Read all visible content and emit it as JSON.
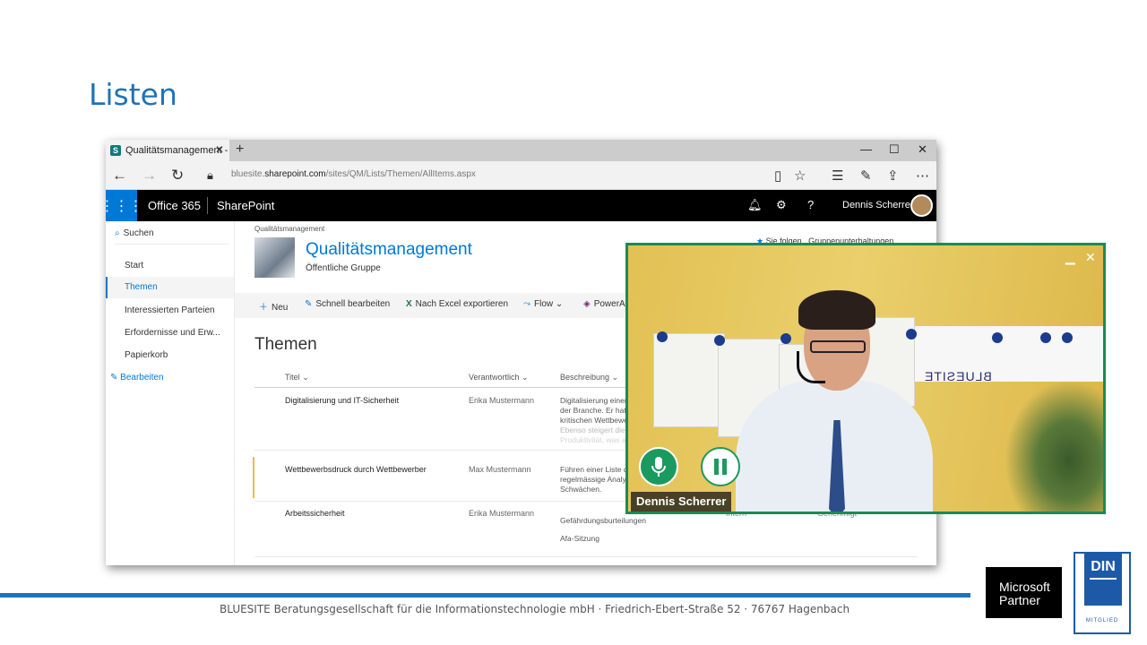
{
  "slide": {
    "title": "Listen",
    "footer": "BLUESITE Beratungsgesellschaft für die Informationstechnologie  mbH · Friedrich-Ebert-Straße 52 · 76767 Hagenbach",
    "ms_partner": [
      "Microsoft",
      "Partner"
    ],
    "din": {
      "text": "DIN",
      "sub": "MITGLIED"
    }
  },
  "browser": {
    "tab_title": "Qualitätsmanagement -",
    "url_prefix": "bluesite.",
    "url_domain": "sharepoint.com",
    "url_path": "/sites/QM/Lists/Themen/AllItems.aspx"
  },
  "o365": {
    "app": "Office 365",
    "product": "SharePoint",
    "user": "Dennis Scherrer"
  },
  "site": {
    "breadcrumb": "Qualitätsmanagement",
    "title": "Qualitätsmanagement",
    "subtitle": "Öffentliche Gruppe",
    "follow": "Sie folgen",
    "conversations": "Gruppenunterhaltungen"
  },
  "nav": {
    "search": "Suchen",
    "items": [
      "Start",
      "Themen",
      "Interessierten Parteien",
      "Erfordernisse und Erw...",
      "Papierkorb"
    ],
    "selected": "Themen",
    "edit": "Bearbeiten"
  },
  "commands": {
    "new": "Neu",
    "quick_edit": "Schnell bearbeiten",
    "excel": "Nach Excel exportieren",
    "flow": "Flow",
    "powerapps": "PowerA"
  },
  "list": {
    "title": "Themen",
    "columns": [
      "Titel",
      "Verantwortlich",
      "Beschreibung"
    ],
    "rows": [
      {
        "title": "Digitalisierung und IT-Sicherheit",
        "responsible": "Erika Mustermann",
        "desc": [
          "Digitalisierung einer",
          "der Branche. Er hat",
          "kritischen Wettbewe",
          "Ebenso steigert die",
          "Produktivität, was a"
        ]
      },
      {
        "title": "Wettbewerbsdruck durch Wettbewerber",
        "responsible": "Max Mustermann",
        "desc": [
          "Führen einer Liste d",
          "regelmässige Analys",
          "Schwächen."
        ]
      },
      {
        "title": "Arbeitssicherheit",
        "responsible": "Erika Mustermann",
        "desc": [
          "Gefährdungsburteilungen",
          "Afa-Sitzung"
        ],
        "extra_left": "Intern",
        "extra_right": "Genehmigt"
      }
    ]
  },
  "video": {
    "name": "Dennis Scherrer",
    "sign": "BLUESITE",
    "accent": "#1c8a55"
  }
}
